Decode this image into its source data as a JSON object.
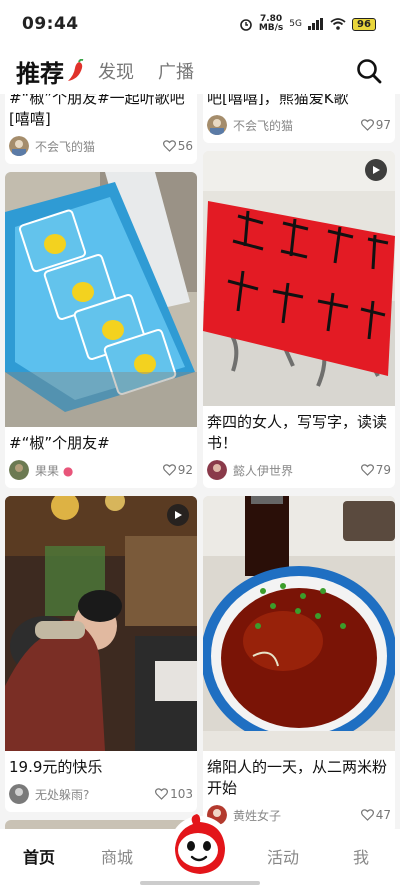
{
  "status": {
    "time": "09:44",
    "speed_value": "7.80",
    "speed_unit": "MB/s",
    "network": "5G",
    "battery": "96"
  },
  "topnav": {
    "tabs": [
      {
        "label": "推荐"
      },
      {
        "label": "发现"
      },
      {
        "label": "广播"
      }
    ]
  },
  "feed": {
    "left": [
      {
        "title": "#“椒”个朋友#一起听歌吧[嘻嘻]",
        "author": "不会飞的猫",
        "likes": "56"
      },
      {
        "title": "#“椒”个朋友#",
        "author": "果果",
        "likes": "92"
      },
      {
        "title": "19.9元的快乐",
        "author": "无处躲雨?",
        "likes": "103"
      }
    ],
    "right": [
      {
        "title": "吧[嘻嘻]，熊猫爱K歌",
        "author": "不会飞的猫",
        "likes": "97"
      },
      {
        "title": "奔四的女人，写写字，读读书！",
        "author": "懿人伊世界",
        "likes": "79"
      },
      {
        "title": "绵阳人的一天，从二两米粉开始",
        "author": "黄姓女子",
        "likes": "47"
      }
    ]
  },
  "bottom_nav": {
    "home": "首页",
    "mall": "商城",
    "activity": "活动",
    "me": "我"
  }
}
